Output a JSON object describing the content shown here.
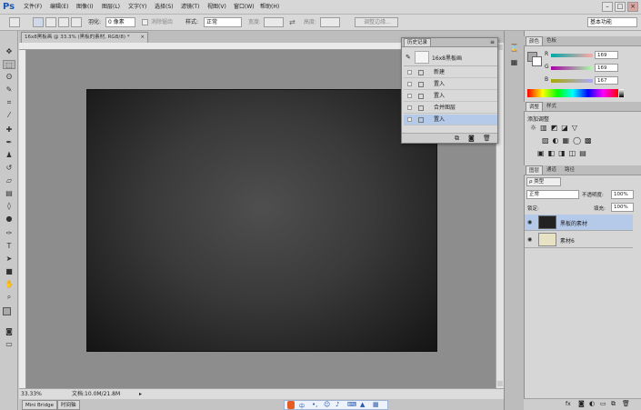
{
  "app": {
    "logo": "Ps"
  },
  "menu": [
    "文件(F)",
    "编辑(E)",
    "图像(I)",
    "图层(L)",
    "文字(Y)",
    "选择(S)",
    "滤镜(T)",
    "视图(V)",
    "窗口(W)",
    "帮助(H)"
  ],
  "window_controls": {
    "minimize": "–",
    "maximize": "□",
    "close": "×"
  },
  "options": {
    "feather_label": "羽化:",
    "feather_value": "0 像素",
    "antialias_label": "消除锯齿",
    "style_label": "样式:",
    "style_value": "正常",
    "width_label": "宽度:",
    "height_label": "高度:",
    "refine_edge": "调整边缘...",
    "workspace": "基本功能"
  },
  "document_tabs": [
    {
      "label": "16x8黑板画 @ 33.3% (黑板的素材, RGB/8) *",
      "close": "×"
    }
  ],
  "status": {
    "zoom": "33.33%",
    "doc": "文档:10.0M/21.8M"
  },
  "bottom_tabs": [
    "Mini Bridge",
    "时间轴"
  ],
  "history": {
    "title": "历史记录",
    "snapshot": "16x8黑板画",
    "items": [
      "新建",
      "置入",
      "置入",
      "合并图层",
      "置入"
    ]
  },
  "color_panel": {
    "tabs": [
      "颜色",
      "色板"
    ],
    "r_label": "R",
    "g_label": "G",
    "b_label": "B",
    "r": "169",
    "g": "169",
    "b": "167"
  },
  "adjust_panel": {
    "tabs": [
      "调整",
      "样式"
    ],
    "title": "添加调整"
  },
  "layers_panel": {
    "tabs": [
      "图层",
      "通道",
      "路径"
    ],
    "filter": "ρ 类型",
    "blend": "正常",
    "opacity_label": "不透明度:",
    "opacity": "100%",
    "lock_label": "锁定:",
    "fill_label": "填充:",
    "fill": "100%",
    "layers": [
      {
        "name": "黑板的素材",
        "selected": true
      },
      {
        "name": "素材6",
        "selected": false
      }
    ],
    "footer": "fx"
  },
  "colors": {
    "accent": "#b5c9e9",
    "canvas_bg": "#8d8d8d"
  }
}
